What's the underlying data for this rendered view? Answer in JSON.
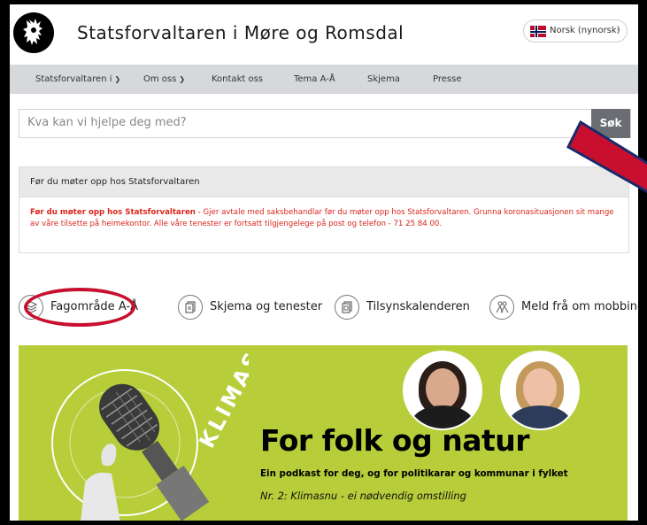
{
  "header": {
    "site_title": "Statsforvaltaren i Møre og Romsdal",
    "language": "Norsk (nynorsk)",
    "logo_icon": "norwegian-lion-icon"
  },
  "nav": {
    "items": [
      {
        "label": "Statsforvaltaren i",
        "has_dropdown": true
      },
      {
        "label": "Om oss",
        "has_dropdown": true
      },
      {
        "label": "Kontakt oss",
        "has_dropdown": false
      },
      {
        "label": "Tema A-Å",
        "has_dropdown": false
      },
      {
        "label": "Skjema",
        "has_dropdown": false
      },
      {
        "label": "Presse",
        "has_dropdown": false
      }
    ]
  },
  "search": {
    "placeholder": "Kva kan vi hjelpe deg med?",
    "button_label": "Søk"
  },
  "alert": {
    "title": "Før du møter opp hos Statsforvaltaren",
    "body_lead": "Før du møter opp hos Statsforvaltaren",
    "body_text": " - Gjer avtale med saksbehandlar før du møter opp hos Statsforvaltaren. Grunna koronasituasjonen sit mange av våre tilsette på heimekontor. Alle våre tenester er fortsatt tilgjengelege på post og telefon - 71 25 84 00.",
    "text_color": "#d9261c"
  },
  "quick_links": [
    {
      "label": "Fagområde A-Å",
      "icon": "layers-icon"
    },
    {
      "label": "Skjema og tenester",
      "icon": "documents-icon"
    },
    {
      "label": "Tilsynskalenderen",
      "icon": "calendar-documents-icon"
    },
    {
      "label": "Meld frå om mobbing",
      "icon": "people-icon"
    }
  ],
  "banner": {
    "title": "For folk og natur",
    "subtitle": "Ein podkast for deg, og for politikarar og kommunar i fylket",
    "episode": "Nr. 2: Klimasnu - ei nødvendig omstilling",
    "art_text": "KLIMASNU",
    "background": "#b7cd3a"
  },
  "colors": {
    "annotation_red": "#c8102e",
    "nav_bg": "#d6d8db",
    "search_button": "#6a6d72"
  }
}
